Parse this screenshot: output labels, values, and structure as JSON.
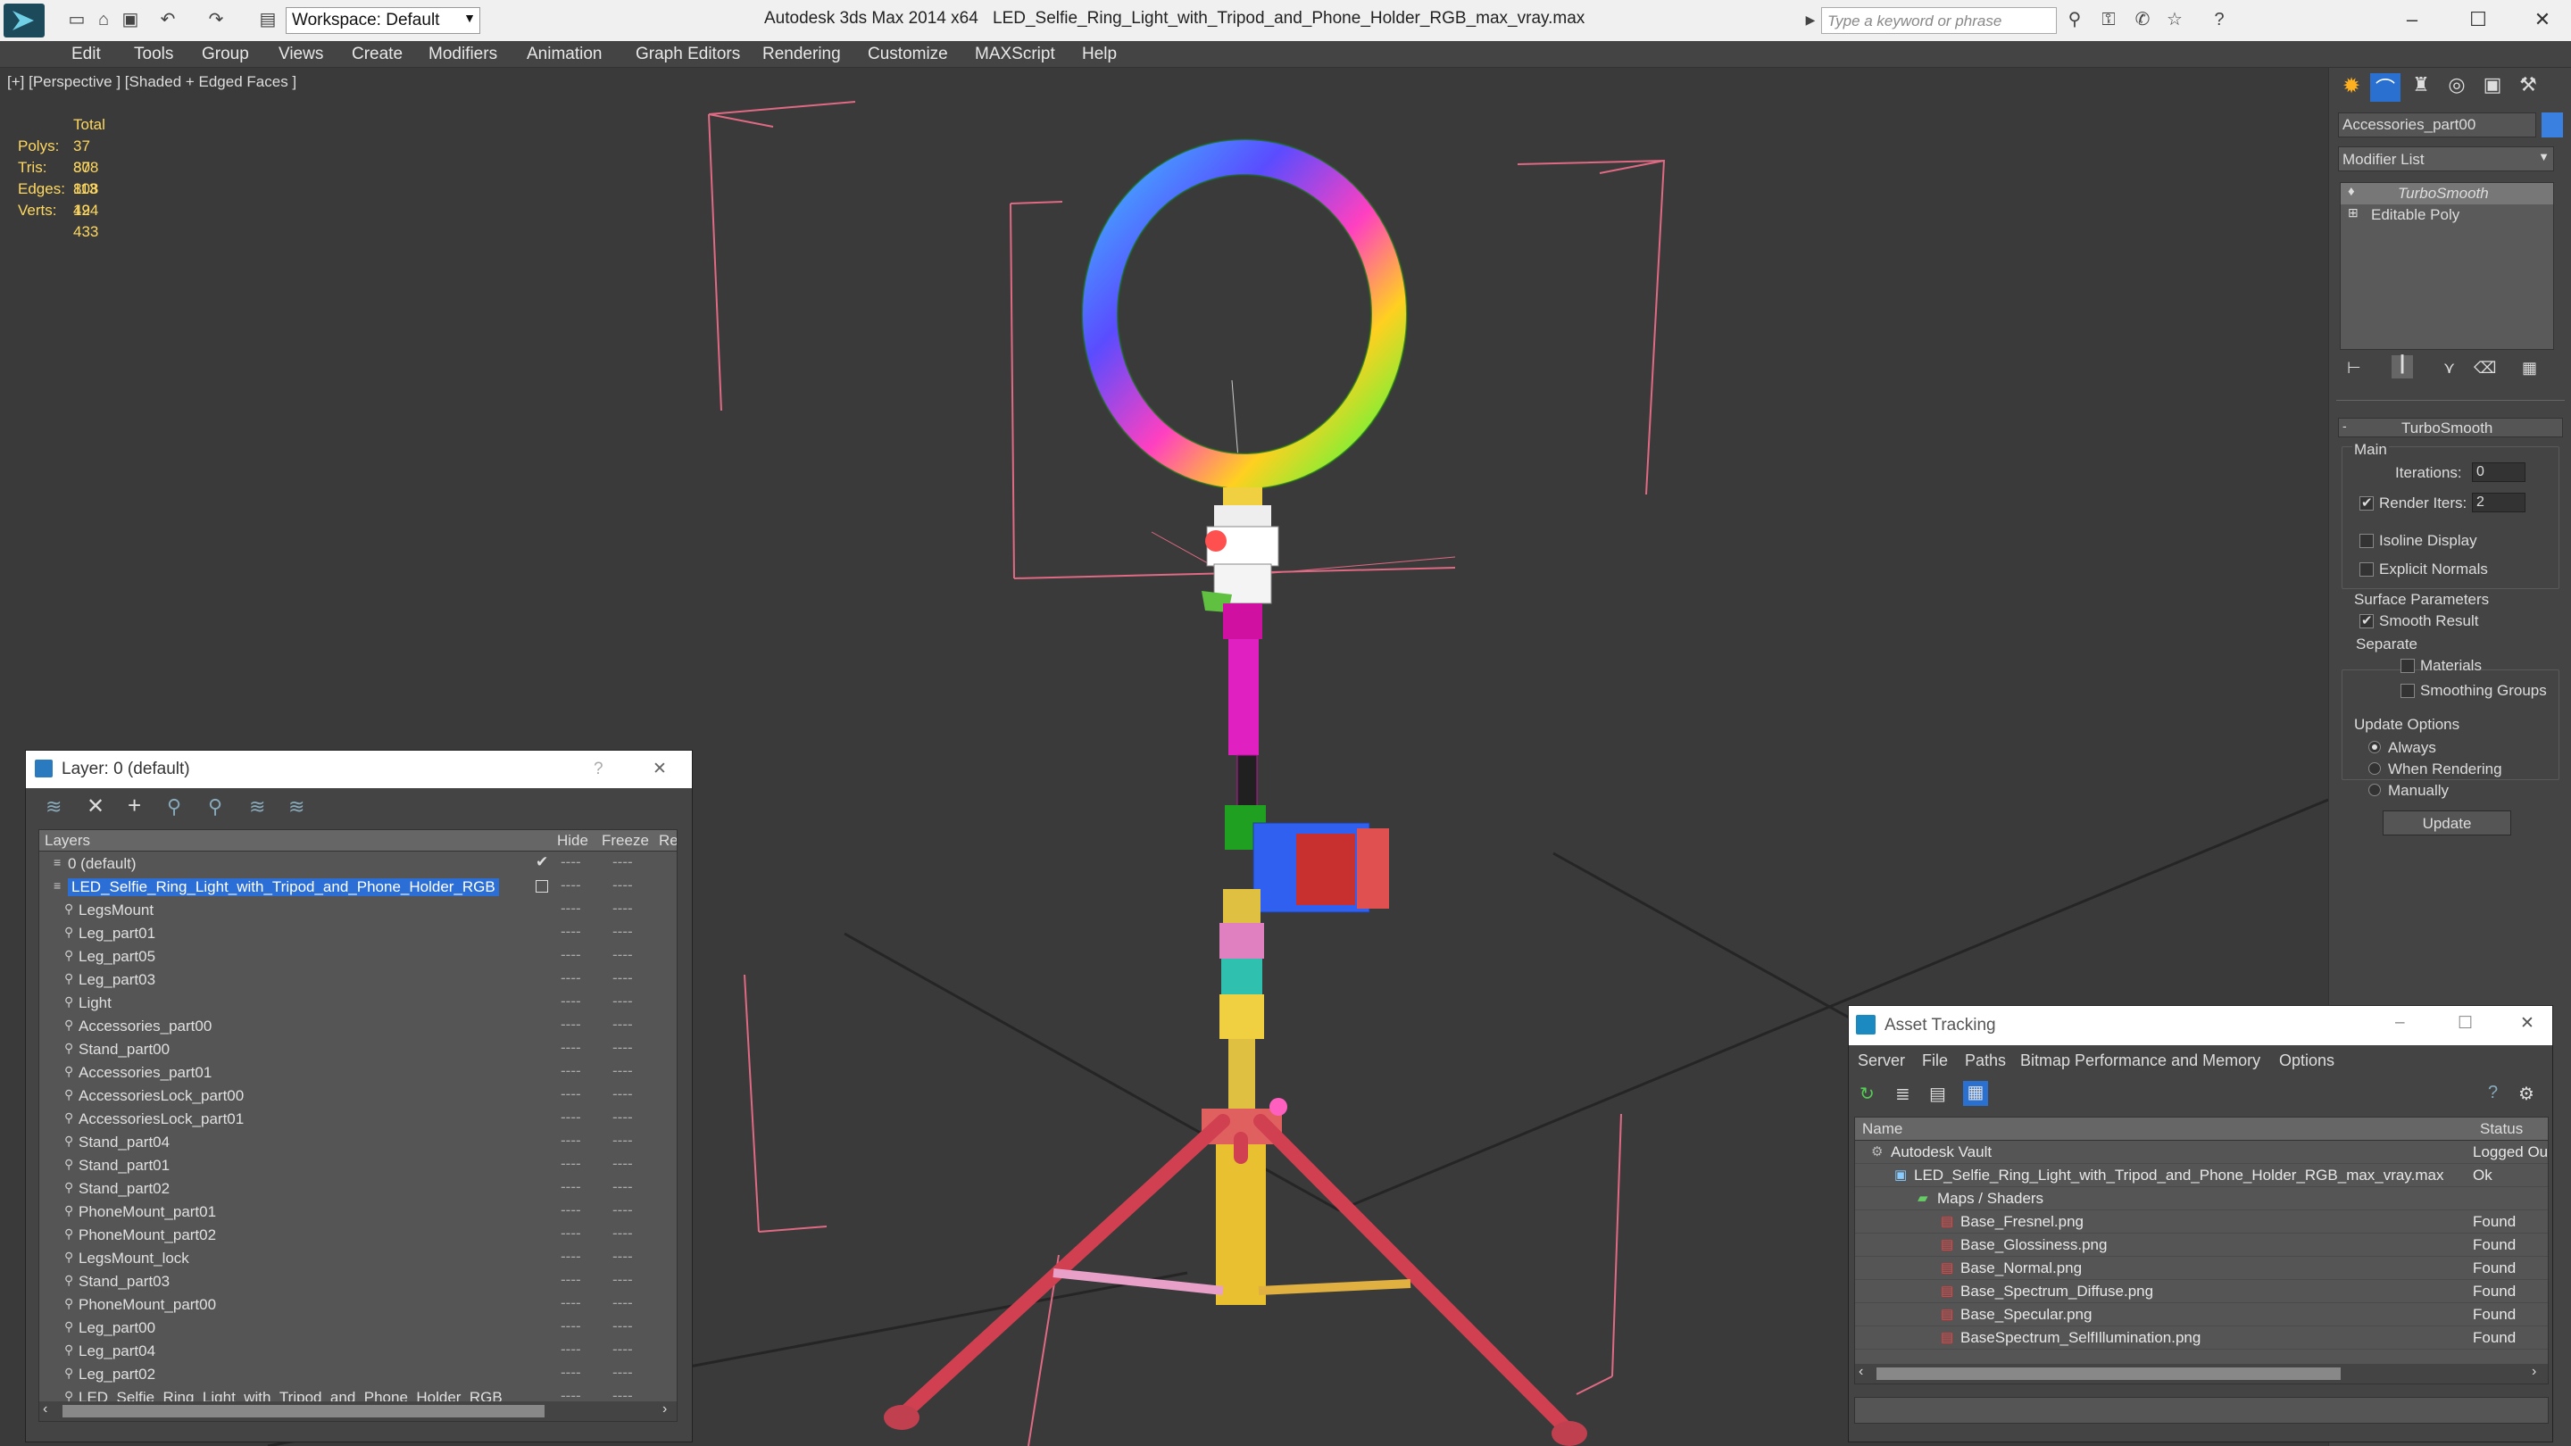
{
  "titlebar": {
    "app_title": "Autodesk 3ds Max  2014 x64",
    "file_title": "LED_Selfie_Ring_Light_with_Tripod_and_Phone_Holder_RGB_max_vray.max",
    "workspace": "Workspace: Default",
    "search_placeholder": "Type a keyword or phrase"
  },
  "menu": [
    "Edit",
    "Tools",
    "Group",
    "Views",
    "Create",
    "Modifiers",
    "Animation",
    "Graph Editors",
    "Rendering",
    "Customize",
    "MAXScript",
    "Help"
  ],
  "viewport": {
    "label": "[+] [Perspective ] [Shaded + Edged Faces ]",
    "stats": {
      "header": "Total",
      "rows": [
        {
          "label": "Polys:",
          "value": "37 808"
        },
        {
          "label": "Tris:",
          "value": "37 808"
        },
        {
          "label": "Edges:",
          "value": "113 424"
        },
        {
          "label": "Verts:",
          "value": "19 433"
        }
      ]
    }
  },
  "command_panel": {
    "object_name": "Accessories_part00",
    "modifier_list": "Modifier List",
    "stack": [
      "TurboSmooth",
      "Editable Poly"
    ],
    "rollout_title": "TurboSmooth",
    "main_label": "Main",
    "iterations_label": "Iterations:",
    "iterations_value": "0",
    "render_iters_label": "Render Iters:",
    "render_iters_value": "2",
    "isoline_label": "Isoline Display",
    "explicit_normals_label": "Explicit Normals",
    "surface_params_label": "Surface Parameters",
    "smooth_result_label": "Smooth Result",
    "separate_label": "Separate",
    "materials_label": "Materials",
    "smoothing_groups_label": "Smoothing Groups",
    "update_options_label": "Update Options",
    "always_label": "Always",
    "when_rendering_label": "When Rendering",
    "manually_label": "Manually",
    "update_button": "Update"
  },
  "layer_dialog": {
    "title": "Layer: 0 (default)",
    "help": "?",
    "close": "✕",
    "columns": [
      "Layers",
      "Hide",
      "Freeze",
      "Re"
    ],
    "layers": [
      {
        "name": "0 (default)",
        "level": 0
      },
      {
        "name": "LED_Selfie_Ring_Light_with_Tripod_and_Phone_Holder_RGB",
        "level": 0
      },
      {
        "name": "LegsMount",
        "level": 1
      },
      {
        "name": "Leg_part01",
        "level": 1
      },
      {
        "name": "Leg_part05",
        "level": 1
      },
      {
        "name": "Leg_part03",
        "level": 1
      },
      {
        "name": "Light",
        "level": 1
      },
      {
        "name": "Accessories_part00",
        "level": 1
      },
      {
        "name": "Stand_part00",
        "level": 1
      },
      {
        "name": "Accessories_part01",
        "level": 1
      },
      {
        "name": "AccessoriesLock_part00",
        "level": 1
      },
      {
        "name": "AccessoriesLock_part01",
        "level": 1
      },
      {
        "name": "Stand_part04",
        "level": 1
      },
      {
        "name": "Stand_part01",
        "level": 1
      },
      {
        "name": "Stand_part02",
        "level": 1
      },
      {
        "name": "PhoneMount_part01",
        "level": 1
      },
      {
        "name": "PhoneMount_part02",
        "level": 1
      },
      {
        "name": "LegsMount_lock",
        "level": 1
      },
      {
        "name": "Stand_part03",
        "level": 1
      },
      {
        "name": "PhoneMount_part00",
        "level": 1
      },
      {
        "name": "Leg_part00",
        "level": 1
      },
      {
        "name": "Leg_part04",
        "level": 1
      },
      {
        "name": "Leg_part02",
        "level": 1
      },
      {
        "name": "LED_Selfie_Ring_Light_with_Tripod_and_Phone_Holder_RGB",
        "level": 1
      }
    ],
    "dash": "----"
  },
  "asset_dialog": {
    "title": "Asset Tracking",
    "menu": [
      "Server",
      "File",
      "Paths",
      "Bitmap Performance and Memory",
      "Options"
    ],
    "columns": [
      "Name",
      "Status"
    ],
    "rows": [
      {
        "name": "Autodesk Vault",
        "status": "Logged Ou",
        "level": 0
      },
      {
        "name": "LED_Selfie_Ring_Light_with_Tripod_and_Phone_Holder_RGB_max_vray.max",
        "status": "Ok",
        "level": 1
      },
      {
        "name": "Maps / Shaders",
        "status": "",
        "level": 2
      },
      {
        "name": "Base_Fresnel.png",
        "status": "Found",
        "level": 3
      },
      {
        "name": "Base_Glossiness.png",
        "status": "Found",
        "level": 3
      },
      {
        "name": "Base_Normal.png",
        "status": "Found",
        "level": 3
      },
      {
        "name": "Base_Spectrum_Diffuse.png",
        "status": "Found",
        "level": 3
      },
      {
        "name": "Base_Specular.png",
        "status": "Found",
        "level": 3
      },
      {
        "name": "BaseSpectrum_SelfIllumination.png",
        "status": "Found",
        "level": 3
      }
    ]
  }
}
